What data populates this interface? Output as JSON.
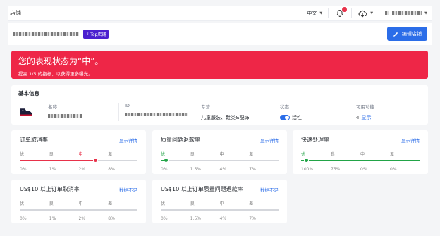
{
  "topbar": {
    "title": "店铺",
    "language": "中文"
  },
  "shop": {
    "badge": "Top店铺",
    "edit_button": "编辑店铺"
  },
  "alert": {
    "headline": "您的表现状态为“中”。",
    "subtext": "提高 1/5 的指标，以获得更多曝光。",
    "color": "#ee2647"
  },
  "basic_info": {
    "heading": "基本信息",
    "name_label": "名称",
    "id_label": "ID",
    "category_label": "专营",
    "category_value": "儿童服装、鞋类&配饰",
    "status_label": "状态",
    "status_value": "活性",
    "features_label": "可用功能",
    "features_count": "4",
    "features_link": "显示"
  },
  "metrics": [
    {
      "title": "订单取消率",
      "action": "显示详情",
      "labels": [
        "优",
        "良",
        "中",
        "差"
      ],
      "ticks": [
        "0%",
        "1%",
        "2%",
        "8%"
      ],
      "level_index": 2,
      "active_color": "#e8324a"
    },
    {
      "title": "质量问题退款率",
      "action": "显示详情",
      "labels": [
        "优",
        "良",
        "中",
        "差"
      ],
      "ticks": [
        "0%",
        "1.5%",
        "4%",
        "7%"
      ],
      "level_index": 0,
      "active_color": "#22a447"
    },
    {
      "title": "快速处理率",
      "action": "显示详情",
      "labels": [
        "优",
        "良",
        "中",
        "差"
      ],
      "ticks": [
        "100%",
        "75%",
        "0%",
        "0%"
      ],
      "level_index": 0,
      "active_color": "#22a447"
    },
    {
      "title": "US$10 以上订单取消率",
      "action": "数据不足",
      "labels": [
        "优",
        "良",
        "中",
        "差"
      ],
      "ticks": [
        "0%",
        "1%",
        "2%",
        "8%"
      ],
      "level_index": -1,
      "active_color": "#d5d7dc"
    },
    {
      "title": "US$10 以上订单质量问题退款率",
      "action": "数据不足",
      "labels": [
        "优",
        "良",
        "中",
        "差"
      ],
      "ticks": [
        "0%",
        "1.5%",
        "4%",
        "7%"
      ],
      "level_index": -1,
      "active_color": "#d5d7dc"
    }
  ]
}
